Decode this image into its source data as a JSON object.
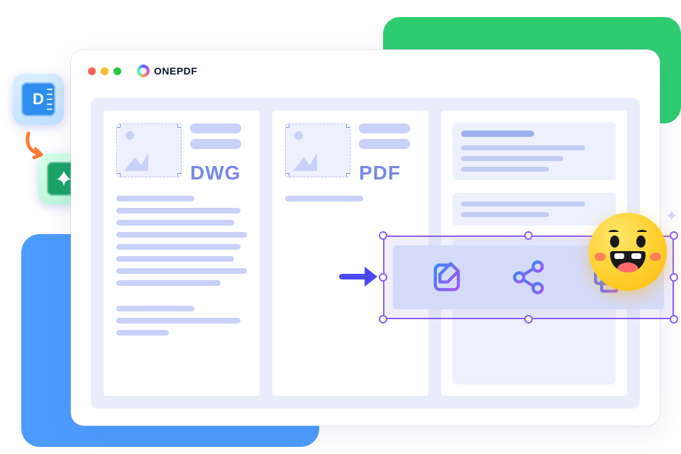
{
  "brand": {
    "name": "ONEPDF"
  },
  "window": {
    "traffic_lights": [
      "close",
      "minimize",
      "zoom"
    ]
  },
  "source": {
    "format_label": "DWG"
  },
  "target": {
    "format_label": "PDF"
  },
  "badges": {
    "dwg_letter": "D",
    "pdf_icon": "acrobat"
  },
  "toolbar": {
    "actions": [
      {
        "id": "edit",
        "name": "edit-icon"
      },
      {
        "id": "share",
        "name": "share-icon"
      },
      {
        "id": "print",
        "name": "print-icon"
      }
    ]
  },
  "decor": {
    "emoji": "happy-face"
  }
}
